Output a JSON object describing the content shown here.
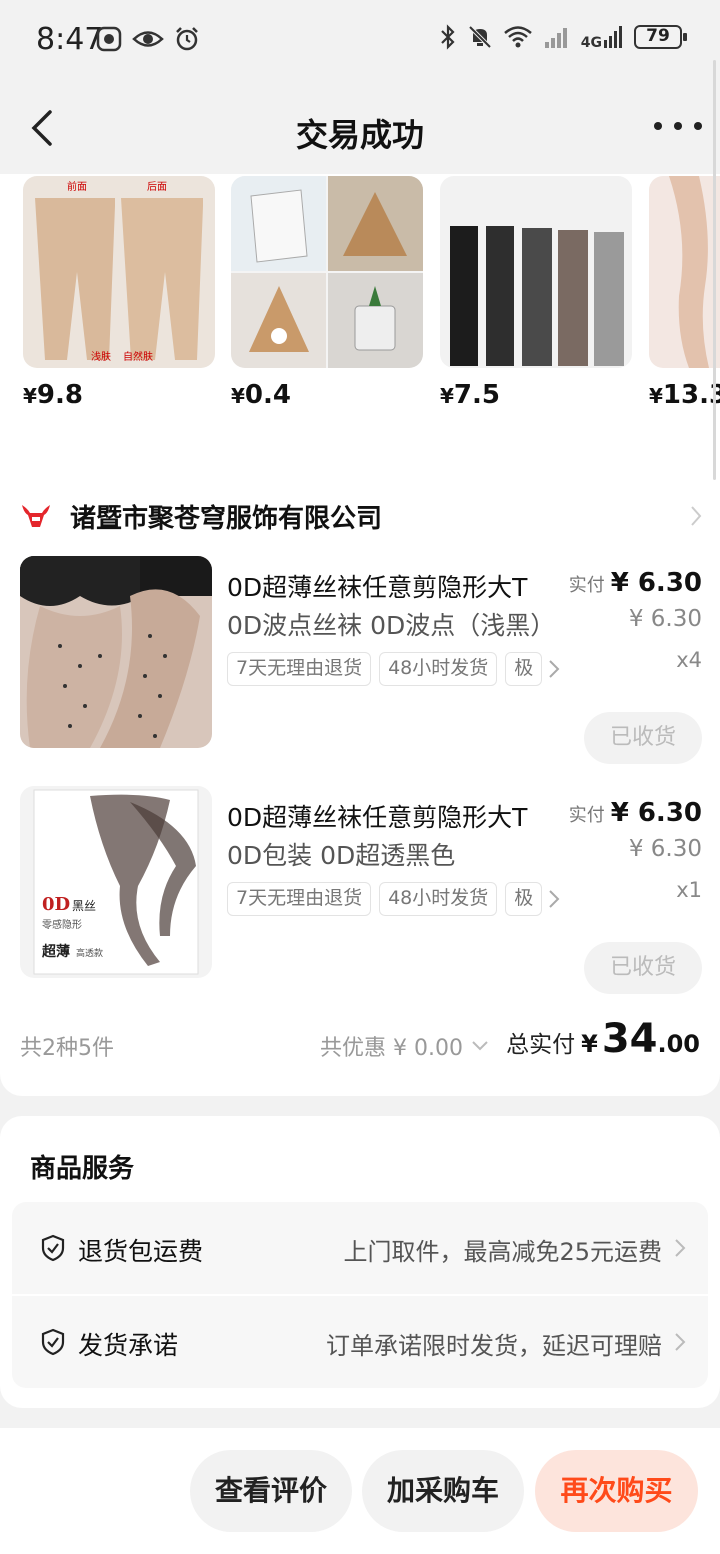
{
  "status_bar": {
    "time": "8:47",
    "network": "4G",
    "battery": "79"
  },
  "nav": {
    "title": "交易成功"
  },
  "recommendations": [
    {
      "price_int": "9.8",
      "currency": "¥"
    },
    {
      "price_int": "0.4",
      "currency": "¥"
    },
    {
      "price_int": "7.5",
      "currency": "¥"
    },
    {
      "price_int": "13.3",
      "currency": "¥"
    }
  ],
  "rec_image_labels": {
    "front": "前面",
    "back": "后面",
    "light": "浅肤",
    "natural": "自然肤"
  },
  "shop": {
    "name": "诸暨市聚苍穹服饰有限公司",
    "items": [
      {
        "title": "0D超薄丝袜任意剪隐形大T",
        "spec": "0D波点丝袜 0D波点（浅黑）",
        "tags": [
          "7天无理由退货",
          "48小时发货",
          "极"
        ],
        "paid_label": "实付",
        "paid_value": "¥ 6.30",
        "original_price": "¥ 6.30",
        "quantity": "x4",
        "status_button": "已收货"
      },
      {
        "title": "0D超薄丝袜任意剪隐形大T",
        "spec": "0D包装 0D超透黑色",
        "tags": [
          "7天无理由退货",
          "48小时发货",
          "极"
        ],
        "paid_label": "实付",
        "paid_value": "¥ 6.30",
        "original_price": "¥ 6.30",
        "quantity": "x1",
        "status_button": "已收货"
      }
    ],
    "package_text": {
      "brand": "0D",
      "brand_sub": "黑丝",
      "line1": "零感隐形",
      "line2": "超薄",
      "line3": "高透款"
    },
    "summary": {
      "count": "共2种5件",
      "discount": "共优惠 ¥ 0.00",
      "total_label": "总实付",
      "total_currency": "¥",
      "total_int": "34",
      "total_dec": ".00"
    }
  },
  "services": {
    "title": "商品服务",
    "rows": [
      {
        "name": "退货包运费",
        "desc": "上门取件，最高减免25元运费"
      },
      {
        "name": "发货承诺",
        "desc": "订单承诺限时发货，延迟可理赔"
      }
    ]
  },
  "bottom_bar": {
    "review": "查看评价",
    "add_cart": "加采购车",
    "rebuy": "再次购买"
  },
  "colors": {
    "accent": "#ff4a1a",
    "rebuy_bg": "#fde4dc",
    "shop_logo": "#e4262c"
  }
}
